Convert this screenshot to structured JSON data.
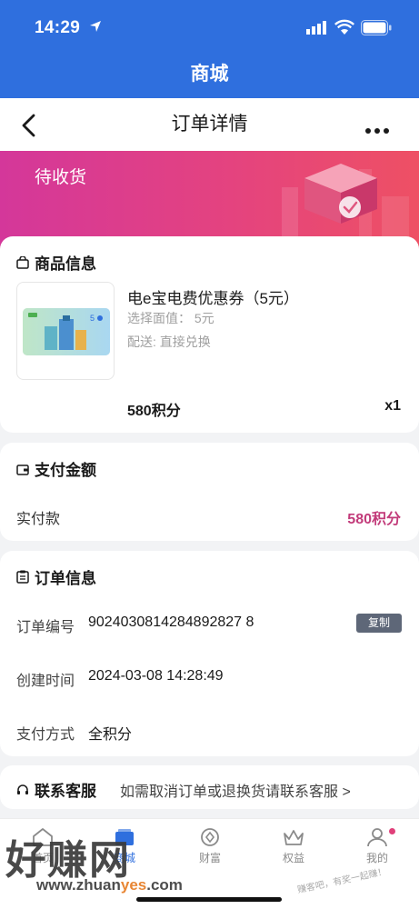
{
  "status_bar": {
    "time": "14:29"
  },
  "app_title": "商城",
  "nav": {
    "title": "订单详情"
  },
  "banner": {
    "status": "待收货"
  },
  "product": {
    "section_title": "商品信息",
    "name": "电e宝电费优惠券（5元）",
    "face_value": "选择面值： 5元",
    "shipping": "配送: 直接兑换",
    "price": "580积分",
    "quantity": "x1"
  },
  "payment": {
    "section_title": "支付金额",
    "label": "实付款",
    "value": "580积分"
  },
  "order_info": {
    "section_title": "订单信息",
    "rows": [
      {
        "label": "订单编号",
        "value": "9024030814284892827 8"
      },
      {
        "label": "创建时间",
        "value": "2024-03-08 14:28:49"
      },
      {
        "label": "支付方式",
        "value": "全积分"
      }
    ],
    "copy_label": "复制"
  },
  "service": {
    "title": "联系客服",
    "hint": "如需取消订单或退换货请联系客服 >"
  },
  "tabbar": {
    "items": [
      {
        "label": "首页",
        "icon": "home-icon"
      },
      {
        "label": "商城",
        "icon": "mall-icon"
      },
      {
        "label": "财富",
        "icon": "wealth-icon"
      },
      {
        "label": "权益",
        "icon": "crown-icon"
      },
      {
        "label": "我的",
        "icon": "profile-icon"
      }
    ]
  },
  "watermark": {
    "main": "好赚网",
    "url_prefix": "www.zhuan",
    "url_accent": "yes",
    "url_suffix": ".com",
    "side": "赚客吧，有奖一起赚！"
  },
  "colors": {
    "brand_blue": "#2f6fde",
    "banner_pink": "#d4379a",
    "accent_points": "#c23b7a",
    "copy_button": "#5e6778"
  }
}
